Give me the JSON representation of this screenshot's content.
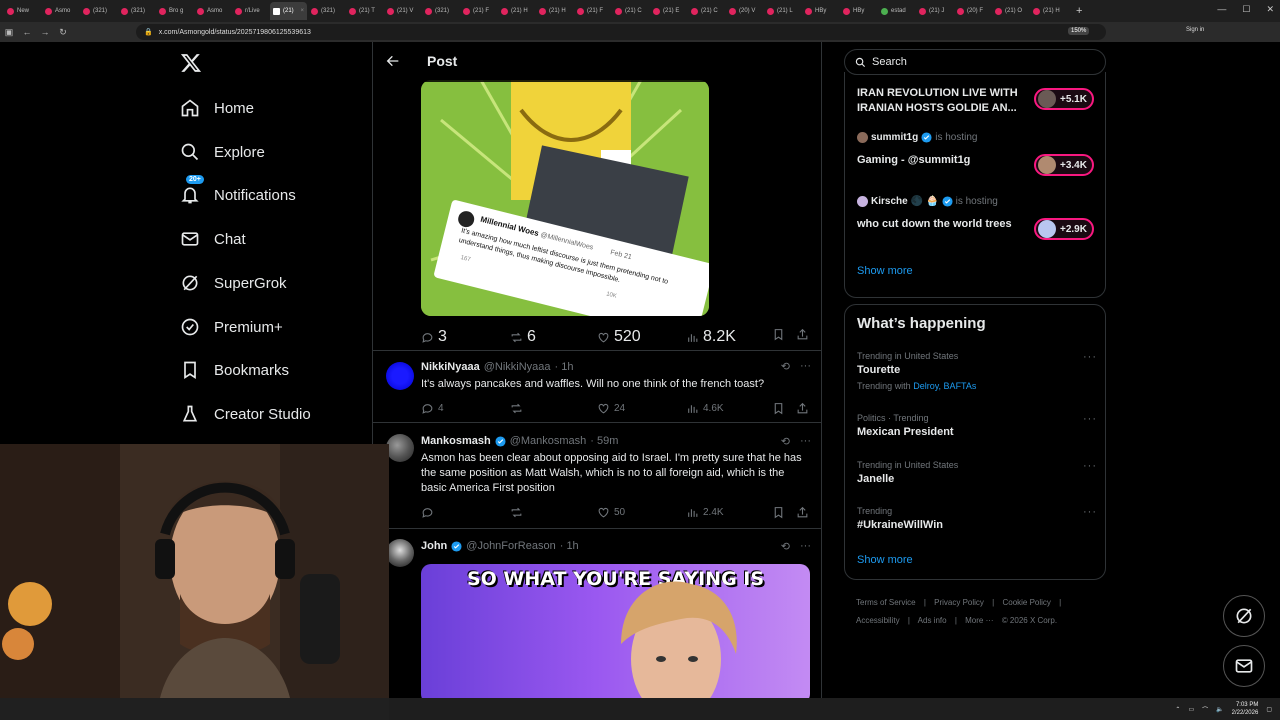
{
  "browser": {
    "tabs": [
      {
        "label": "New"
      },
      {
        "label": "Asmo"
      },
      {
        "label": "(321)"
      },
      {
        "label": "(321)"
      },
      {
        "label": "Bro g"
      },
      {
        "label": "Asmo"
      },
      {
        "label": "r/Live"
      },
      {
        "label": "(21)",
        "active": true
      },
      {
        "label": "(321)"
      },
      {
        "label": "(21) T"
      },
      {
        "label": "(21) V"
      },
      {
        "label": "(321)"
      },
      {
        "label": "(21) F"
      },
      {
        "label": "(21) H"
      },
      {
        "label": "(21) H"
      },
      {
        "label": "(21) F"
      },
      {
        "label": "(21) C"
      },
      {
        "label": "(21) E"
      },
      {
        "label": "(21) C"
      },
      {
        "label": "(20) V"
      },
      {
        "label": "(21) L"
      },
      {
        "label": "HBy"
      },
      {
        "label": "HBy"
      },
      {
        "label": "estad"
      },
      {
        "label": "(21) J"
      },
      {
        "label": "(20) F"
      },
      {
        "label": "(21) O"
      },
      {
        "label": "(21) H"
      }
    ],
    "url": "x.com/Asmongold/status/2025719806125539613",
    "zoom": "150%",
    "signin": "Sign in"
  },
  "nav": {
    "items": [
      {
        "label": "Home"
      },
      {
        "label": "Explore"
      },
      {
        "label": "Notifications",
        "badge": "20+"
      },
      {
        "label": "Chat"
      },
      {
        "label": "SuperGrok"
      },
      {
        "label": "Premium+"
      },
      {
        "label": "Bookmarks"
      },
      {
        "label": "Creator Studio"
      }
    ]
  },
  "post": {
    "header_title": "Post",
    "meme1": {
      "card_author": "Millennial Woes",
      "card_handle": "@MillennialWoes",
      "card_date": "Feb 21",
      "card_text": "It's amazing how much leftist discourse is just them pretending not to understand things, thus making discourse impossible.",
      "card_stats": [
        "167",
        "10K"
      ]
    },
    "stats": {
      "replies": "3",
      "reposts": "6",
      "likes": "520",
      "views": "8.2K"
    }
  },
  "replies": [
    {
      "name": "NikkiNyaaa",
      "handle": "@NikkiNyaaa",
      "time": "· 1h",
      "text": "It's always pancakes and waffles. Will no one think of the french toast?",
      "replies": "4",
      "reposts": "",
      "likes": "24",
      "views": "4.6K"
    },
    {
      "name": "Mankosmash",
      "handle": "@Mankosmash",
      "time": "· 59m",
      "text": "Asmon has been clear about opposing aid to Israel. I'm pretty sure that he has the same position as Matt Walsh, which is no to all foreign aid, which is the basic America First position",
      "replies": "",
      "reposts": "",
      "likes": "50",
      "views": "2.4K"
    },
    {
      "name": "John",
      "handle": "@JohnForReason",
      "time": "· 1h",
      "meme_text": "SO WHAT YOU'RE SAYING IS"
    }
  ],
  "right": {
    "search_placeholder": "Search",
    "live": [
      {
        "title": "IRAN REVOLUTION LIVE WITH IRANIAN HOSTS GOLDIE AN...",
        "count": "+5.1K"
      },
      {
        "host": "summit1g",
        "hosting": "is hosting",
        "title": "Gaming - @summit1g",
        "count": "+3.4K"
      },
      {
        "host": "Kirsche",
        "hosting": "is hosting",
        "title": "who cut down the world trees",
        "count": "+2.9K"
      }
    ],
    "show_more": "Show more",
    "happening_title": "What’s happening",
    "trends": [
      {
        "meta": "Trending in United States",
        "name": "Tourette",
        "with_label": "Trending with",
        "with_links": "Delroy, BAFTAs"
      },
      {
        "meta": "Politics · Trending",
        "name": "Mexican President"
      },
      {
        "meta": "Trending in United States",
        "name": "Janelle"
      },
      {
        "meta": "Trending",
        "name": "#UkraineWillWin"
      }
    ],
    "show_more_2": "Show more",
    "footer": {
      "links": [
        "Terms of Service",
        "|",
        "Privacy Policy",
        "|",
        "Cookie Policy",
        "|"
      ],
      "links2": [
        "Accessibility",
        "|",
        "Ads info",
        "|",
        "More ···",
        "© 2026 X Corp."
      ]
    }
  },
  "taskbar": {
    "time": "7:03 PM",
    "date": "2/22/2026"
  },
  "colors": {
    "accent": "#1d9bf0",
    "live_pink": "#f91880",
    "muted": "#71767b",
    "border": "#2f3336"
  }
}
